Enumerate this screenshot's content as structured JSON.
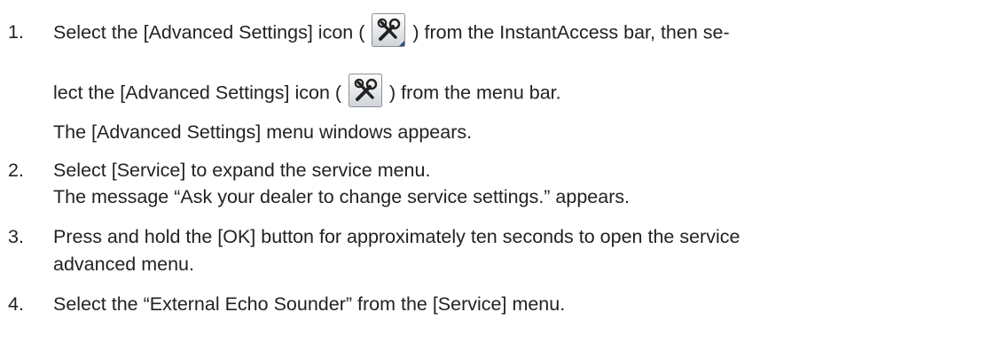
{
  "steps": [
    {
      "number": "1.",
      "line1_before": "Select the [Advanced Settings] icon (",
      "line1_after": ") from the InstantAccess bar, then se-",
      "line2_before": "lect the [Advanced Settings] icon (",
      "line2_after": ") from the menu bar.",
      "line3": "The [Advanced Settings] menu windows appears.",
      "icon1": "advanced-settings-icon-with-submenu-corner",
      "icon2": "advanced-settings-icon"
    },
    {
      "number": "2.",
      "line1": "Select [Service] to expand the service menu.",
      "line2": "The message “Ask your dealer to change service settings.” appears."
    },
    {
      "number": "3.",
      "line1": "Press and hold the [OK] button for approximately ten seconds to open the service",
      "line2": "advanced menu."
    },
    {
      "number": "4.",
      "line1": "Select the “External Echo Sounder” from the [Service] menu."
    }
  ]
}
